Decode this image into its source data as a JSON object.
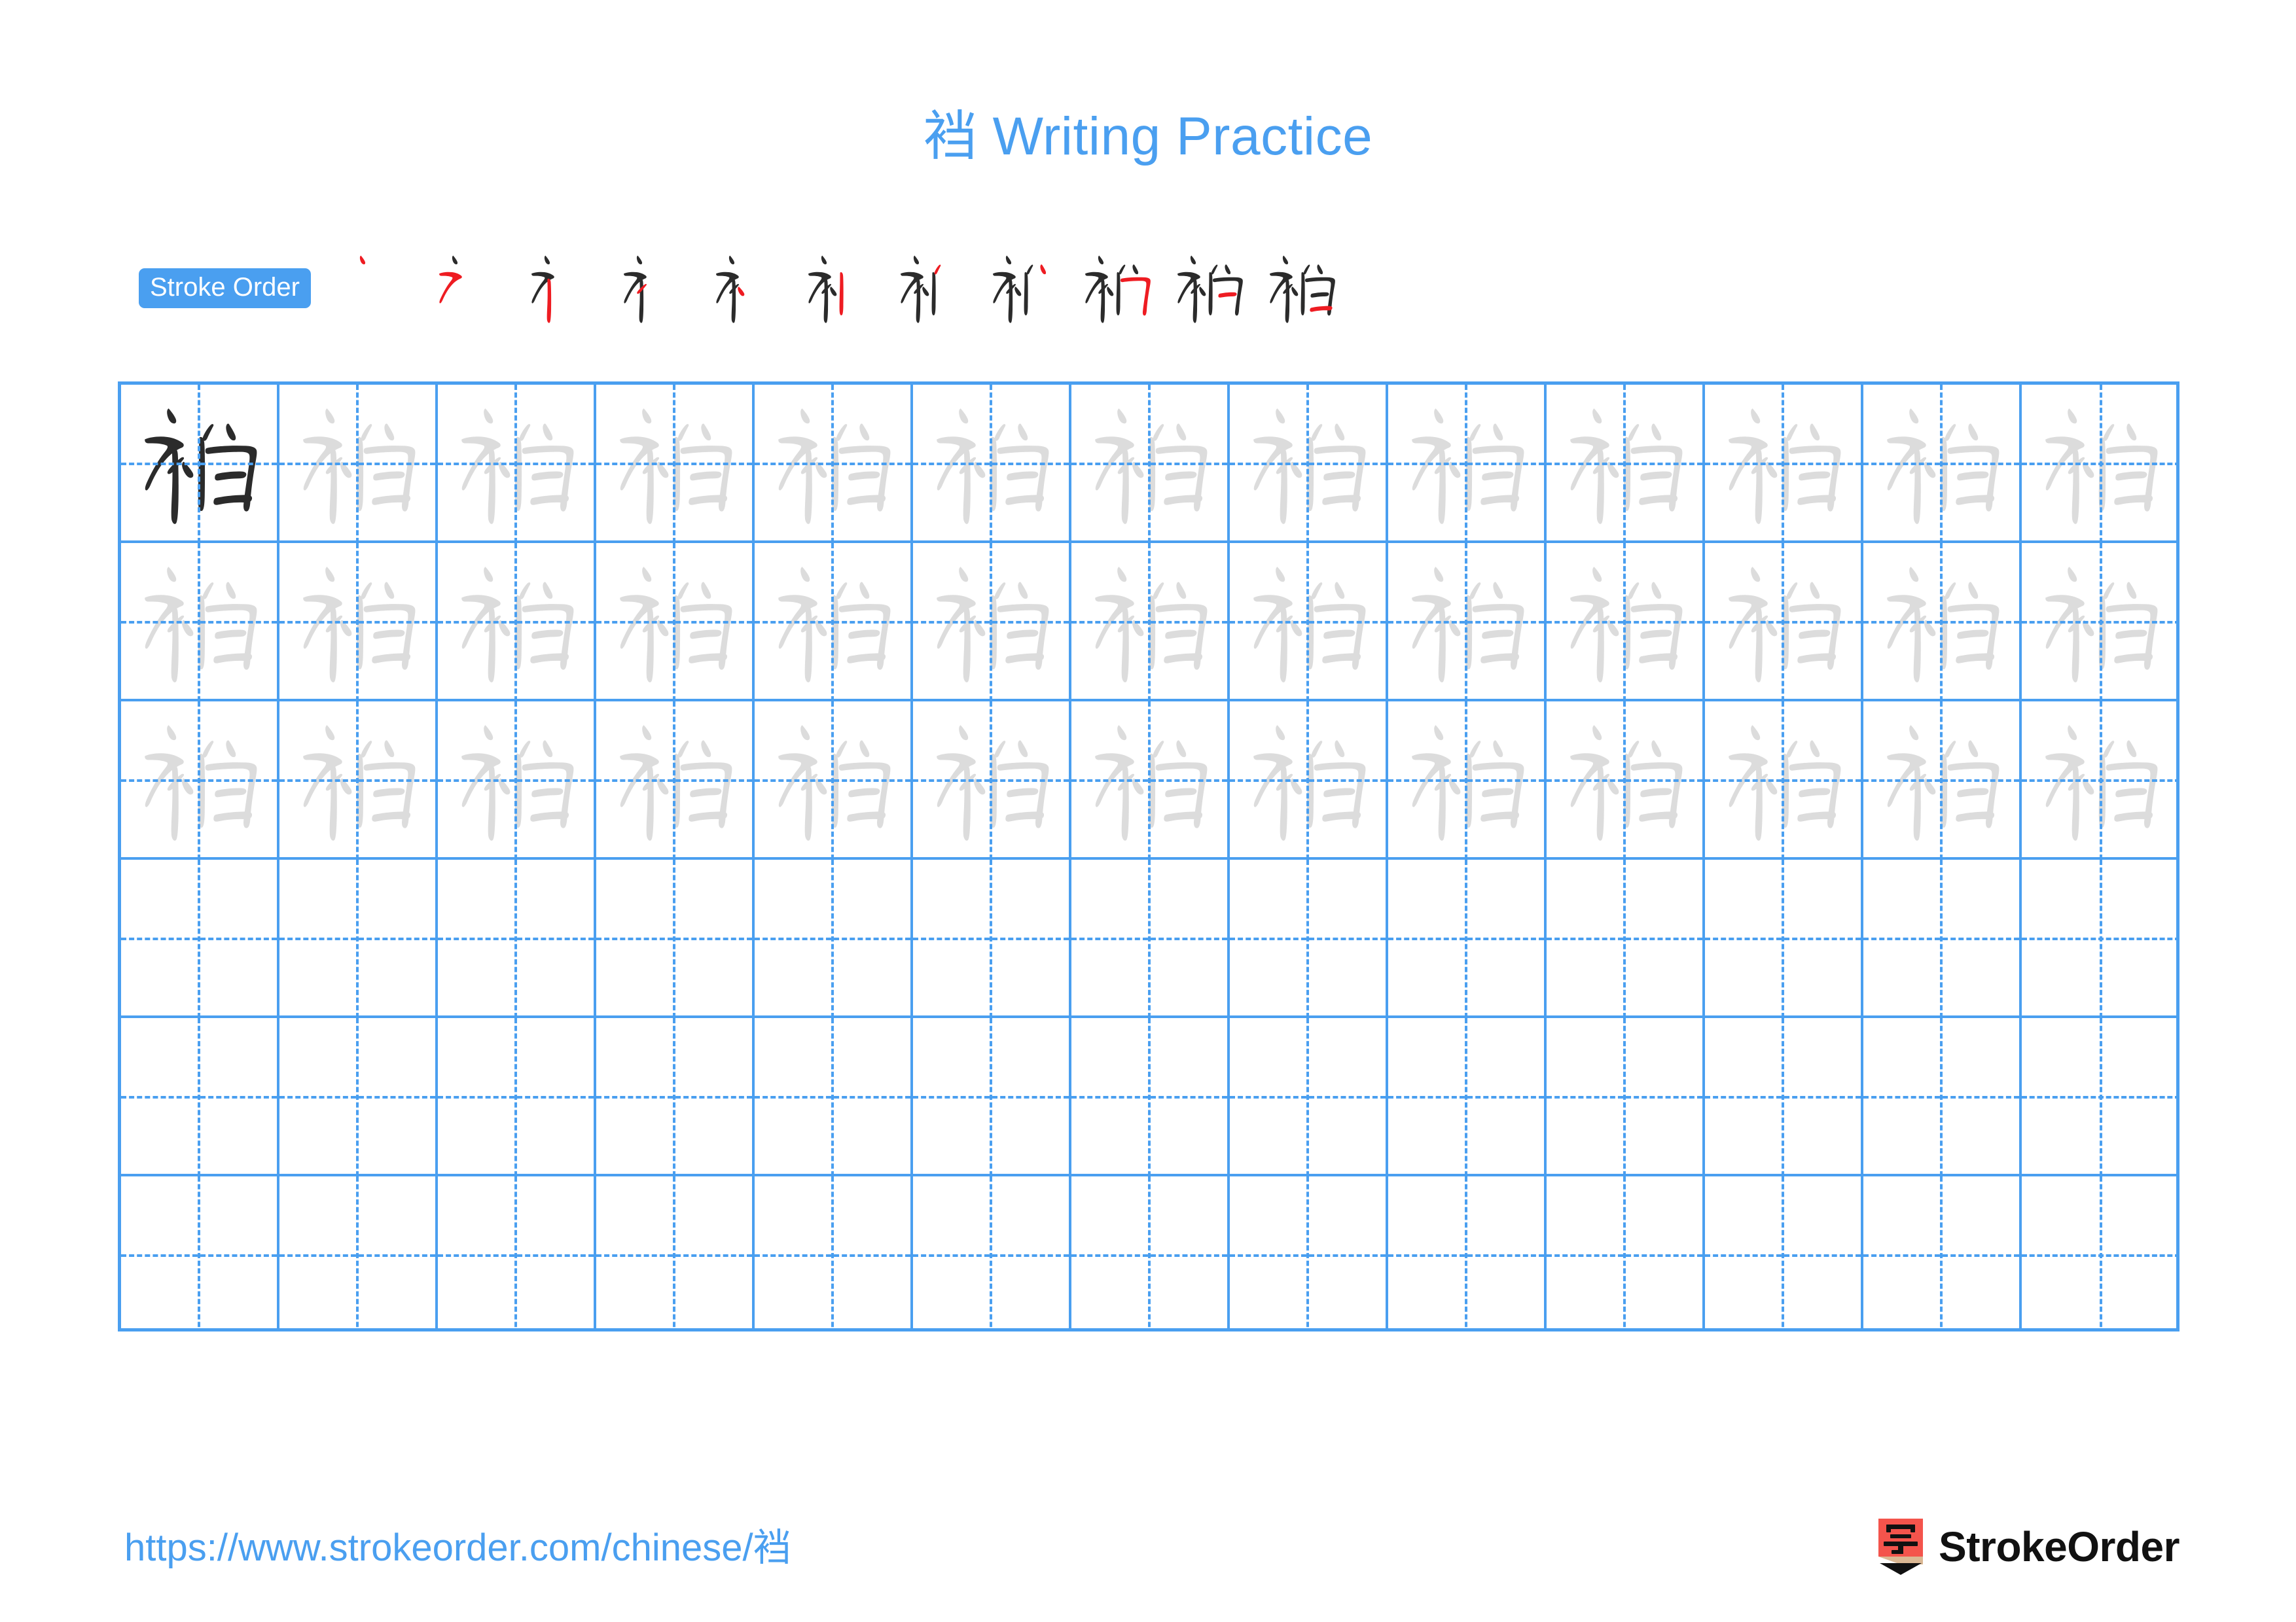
{
  "page": {
    "character": "裆",
    "title_suffix": " Writing Practice",
    "title_full": "裆 Writing Practice",
    "accent_color": "#4A9FF0",
    "grid_line_color": "#4A9FF0",
    "template_char_color": "#DCDCDC",
    "solid_char_color": "#2B2B2B",
    "new_stroke_color": "#EE1C22"
  },
  "stroke_order": {
    "badge_label": "Stroke Order",
    "step_count": 11,
    "steps": [
      {
        "index": 1,
        "strokes_drawn": 1,
        "new_stroke": "dot"
      },
      {
        "index": 2,
        "strokes_drawn": 2,
        "new_stroke": "horizontal-throw"
      },
      {
        "index": 3,
        "strokes_drawn": 3,
        "new_stroke": "vertical"
      },
      {
        "index": 4,
        "strokes_drawn": 4,
        "new_stroke": "short-throw"
      },
      {
        "index": 5,
        "strokes_drawn": 5,
        "new_stroke": "dot-right"
      },
      {
        "index": 6,
        "strokes_drawn": 6,
        "new_stroke": "vertical-right"
      },
      {
        "index": 7,
        "strokes_drawn": 7,
        "new_stroke": "dot-left-upper"
      },
      {
        "index": 8,
        "strokes_drawn": 8,
        "new_stroke": "dot-right-upper"
      },
      {
        "index": 9,
        "strokes_drawn": 9,
        "new_stroke": "horizontal-hook"
      },
      {
        "index": 10,
        "strokes_drawn": 10,
        "new_stroke": "horizontal-inner"
      },
      {
        "index": 11,
        "strokes_drawn": 11,
        "new_stroke": "horizontal-bottom"
      }
    ]
  },
  "practice_grid": {
    "columns": 13,
    "rows": 6,
    "rows_data": [
      {
        "row": 1,
        "filled": true,
        "first_cell_solid": true
      },
      {
        "row": 2,
        "filled": true,
        "first_cell_solid": false
      },
      {
        "row": 3,
        "filled": true,
        "first_cell_solid": false
      },
      {
        "row": 4,
        "filled": false,
        "first_cell_solid": false
      },
      {
        "row": 5,
        "filled": false,
        "first_cell_solid": false
      },
      {
        "row": 6,
        "filled": false,
        "first_cell_solid": false
      }
    ]
  },
  "footer": {
    "url": "https://www.strokeorder.com/chinese/裆",
    "brand_name": "StrokeOrder",
    "logo_char": "字",
    "logo_body_color": "#F4544C",
    "logo_wood_color": "#DBB894",
    "logo_tip_color": "#111111"
  }
}
